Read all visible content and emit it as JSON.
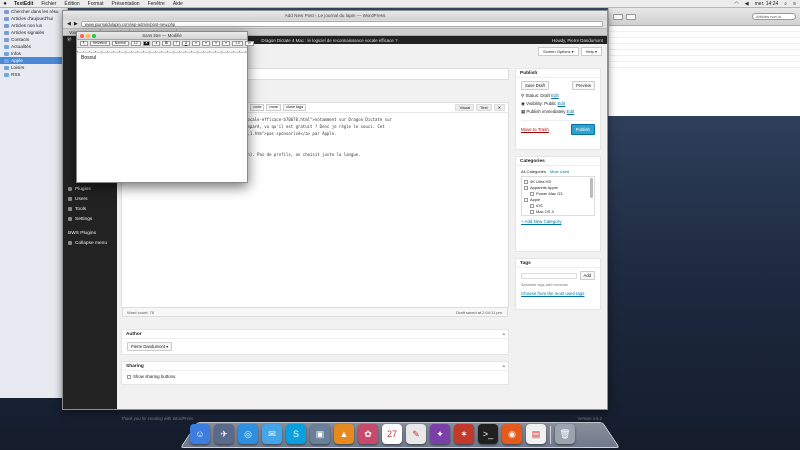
{
  "menubar": {
    "app": "TextEdit",
    "items": [
      "Fichier",
      "Édition",
      "Format",
      "Présentation",
      "Fenêtre",
      "Aide"
    ],
    "clock": "mer. 14:24"
  },
  "finder": {
    "items": [
      {
        "label": "Chercher dans les résu",
        "type": "doc"
      },
      {
        "label": "Articles d'aujourd'hui",
        "type": "doc"
      },
      {
        "label": "Articles non lus",
        "type": "doc"
      },
      {
        "label": "Articles signalés",
        "type": "doc"
      },
      {
        "label": "Contacts",
        "type": "doc"
      },
      {
        "label": "Actualités",
        "type": "folder"
      },
      {
        "label": "Infos",
        "type": "folder"
      },
      {
        "label": "Apple",
        "type": "folder",
        "selected": true
      },
      {
        "label": "Loisirs",
        "type": "folder"
      },
      {
        "label": "RSS",
        "type": "folder"
      }
    ]
  },
  "rightwin": {
    "search": "Articles non lu"
  },
  "browser": {
    "title": "Add New Post ‹ Le journal du lapin — WordPress",
    "url": "www.journaldulapin.com/wp-admin/post-new.php",
    "tabs": [
      "VoiceWorm 7",
      "MacBidz",
      "Le journal du lapin"
    ]
  },
  "wp": {
    "bar_title": "Dragon Dictate 4 Mac : le logiciel de reconnaissance vocale efficace ?",
    "howdy": "Howdy, Pierre Dandumont",
    "screen_options": "Screen Options ▾",
    "help": "Help ▾",
    "menu": [
      "Plugins",
      "Users",
      "Tools",
      "Settings",
      "BWS Plugins",
      "Collapse menu"
    ],
    "post_title": "vocale efficace ?",
    "permalink_slug": "vocale-efficace/",
    "permalink_edit": "Edit",
    "permalink_view": "View Post",
    "editor_modes": [
      "Visual",
      "Text"
    ],
    "quicktags": [
      "b",
      "i",
      "link",
      "b-quote",
      "del",
      "ins",
      "img",
      "ul",
      "ol",
      "li",
      "code",
      "more",
      "close tags"
    ],
    "content_lines": [
      "ers/dragon-dictate-4-mac-logiciel-reconnaissance-vocale-efficace-b70670.html\">notamment sur Dragon Dictate sur",
      "ce que le logiciel intégré à Mac OS X n'est pas comparé, vu qu'il est gratuit ? Donc je règle le souci. Cet",
      "ualites,nuance-dragon-naturally-speaking-13,550565,1.htm\">pas sponsorisé</a> par Apple.",
      "",
      "",
      "as) et on choisit son micro (ici celui de mon écran). Pas de profils, on choisit juste la langue."
    ],
    "word_count": "Word count: 76",
    "draft_saved": "Draft saved at 2:04:11 pm.",
    "author_title": "Author",
    "author_value": "Pierre Dandumont ▾",
    "sharing_title": "Sharing",
    "sharing_label": "Show sharing buttons.",
    "footer": "Thank you for creating with WordPress.",
    "version": "Version 3.9.2"
  },
  "publish": {
    "title": "Publish",
    "save_draft": "Save Draft",
    "preview": "Preview",
    "status": "Status: Draft",
    "visibility": "Visibility: Public",
    "schedule": "Publish immediately",
    "edit": "Edit",
    "trash": "Move to Trash",
    "publish": "Publish"
  },
  "categories": {
    "title": "Categories",
    "tab_all": "All Categories",
    "tab_used": "Most Used",
    "items": [
      {
        "label": "4K Ultra HD",
        "indent": 0
      },
      {
        "label": "Apparells Apple",
        "indent": 0
      },
      {
        "label": "Power Mac G3",
        "indent": 1
      },
      {
        "label": "Apple",
        "indent": 0
      },
      {
        "label": "iOS",
        "indent": 1
      },
      {
        "label": "Mac OS X",
        "indent": 1
      },
      {
        "label": "OS X",
        "indent": 1
      },
      {
        "label": "Yosemite",
        "indent": 1
      }
    ],
    "add_new": "+ Add New Category"
  },
  "tags": {
    "title": "Tags",
    "add": "Add",
    "hint": "Separate tags with commas",
    "choose": "Choose from the most used tags"
  },
  "textedit": {
    "title": "Sans titre — Modifié",
    "font": "Helvetica",
    "style": "Normal",
    "size": "12",
    "text": "Bosoul"
  },
  "dock": {
    "apps": [
      {
        "name": "finder-icon",
        "color": "#3b7de0",
        "glyph": "☺"
      },
      {
        "name": "launchpad-icon",
        "color": "#5a6a8a",
        "glyph": "✈"
      },
      {
        "name": "safari-icon",
        "color": "#2c8fe0",
        "glyph": "◎"
      },
      {
        "name": "messages-icon",
        "color": "#44a6e8",
        "glyph": "✉"
      },
      {
        "name": "skype-icon",
        "color": "#0aa0e0",
        "glyph": "S"
      },
      {
        "name": "preview-icon",
        "color": "#6a7f9a",
        "glyph": "▣"
      },
      {
        "name": "vlc-icon",
        "color": "#e58a1f",
        "glyph": "▲"
      },
      {
        "name": "photos-icon",
        "color": "#c64b6a",
        "glyph": "✿"
      },
      {
        "name": "calendar-icon",
        "color": "#ffffff",
        "glyph": "27"
      },
      {
        "name": "textedit-icon",
        "color": "#e8e8e8",
        "glyph": "✎"
      },
      {
        "name": "utility-icon",
        "color": "#7b3fa8",
        "glyph": "✦"
      },
      {
        "name": "transmission-icon",
        "color": "#c0392b",
        "glyph": "✶"
      },
      {
        "name": "terminal-icon",
        "color": "#202020",
        "glyph": ">_"
      },
      {
        "name": "firefox-icon",
        "color": "#e65a1b",
        "glyph": "◉"
      },
      {
        "name": "document-icon",
        "color": "#f1f1f1",
        "glyph": "▤"
      },
      {
        "name": "trash-icon",
        "color": "#9aa3ae",
        "glyph": "🗑"
      }
    ]
  }
}
